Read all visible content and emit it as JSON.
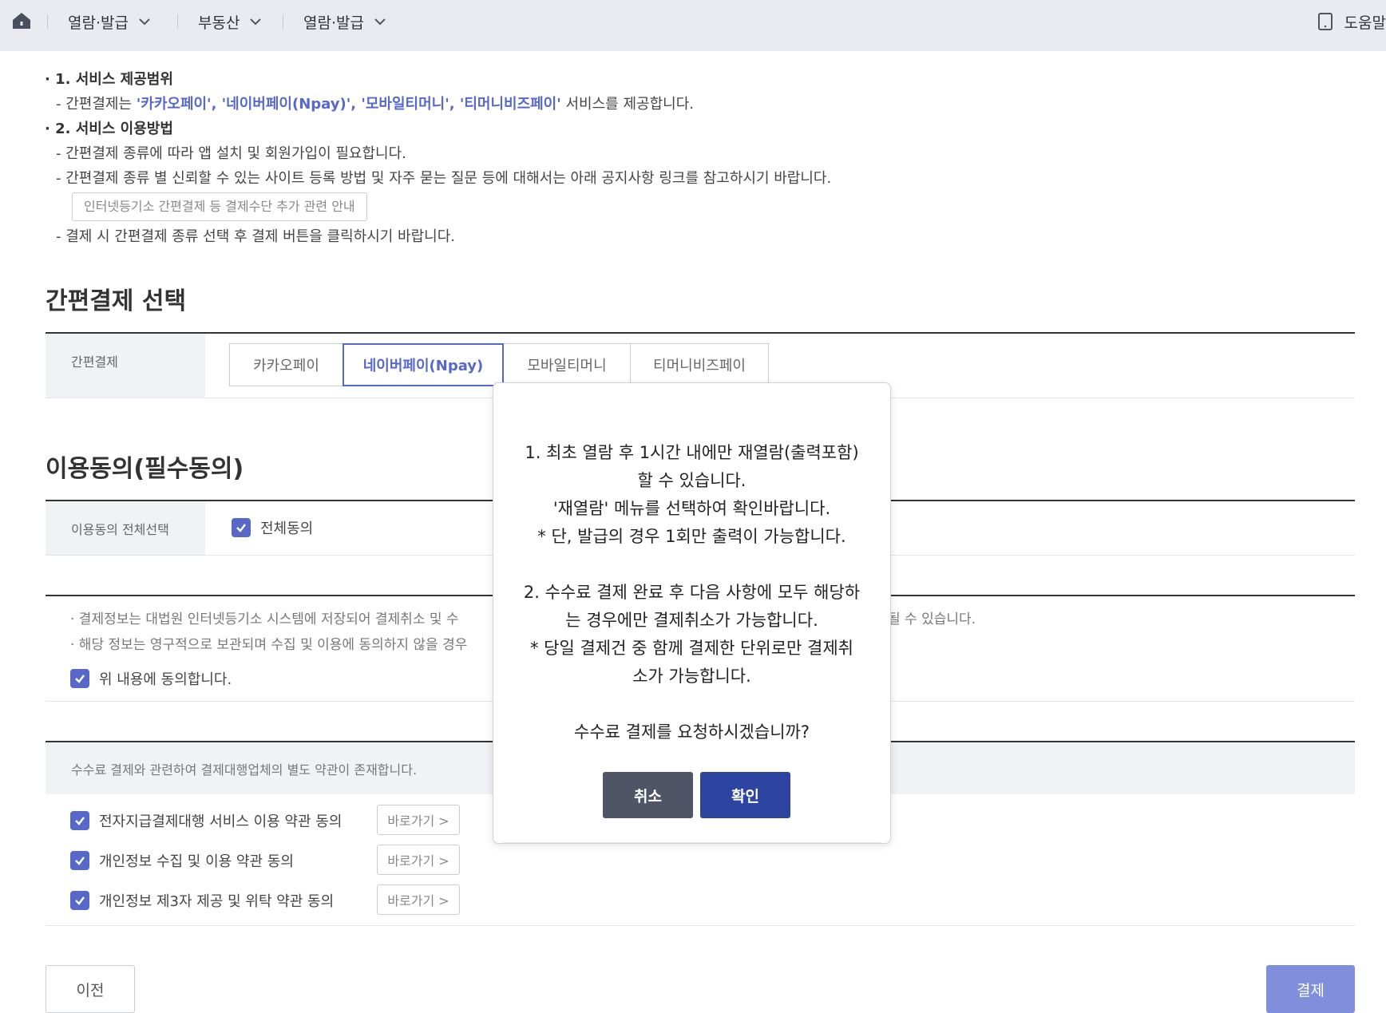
{
  "nav": {
    "items": [
      {
        "label": "열람·발급"
      },
      {
        "label": "부동산"
      },
      {
        "label": "열람·발급"
      }
    ],
    "help_label": "도움말"
  },
  "info": {
    "s1_title": "· 1. 서비스 제공범위",
    "s1_line_prefix": "- 간편결제는 ",
    "s1_highlight": "'카카오페이', '네이버페이(Npay)', '모바일티머니', '티머니비즈페이'",
    "s1_line_suffix": " 서비스를 제공합니다.",
    "s2_title": "· 2. 서비스 이용방법",
    "s2_line1": "- 간편결제 종류에 따라 앱 설치 및 회원가입이 필요합니다.",
    "s2_line2": "- 간편결제 종류 별 신뢰할 수 있는 사이트 등록 방법 및 자주 묻는 질문 등에 대해서는 아래 공지사항 링크를 참고하시기 바랍니다.",
    "notice_button": "인터넷등기소 간편결제 등 결제수단 추가 관련 안내",
    "s2_line3": "- 결제 시 간편결제 종류 선택 후 결제 버튼을 클릭하시기 바랍니다."
  },
  "easy_pay": {
    "section_title": "간편결제 선택",
    "label": "간편결제",
    "tabs": [
      {
        "label": "카카오페이"
      },
      {
        "label": "네이버페이(Npay)"
      },
      {
        "label": "모바일티머니"
      },
      {
        "label": "티머니비즈페이"
      }
    ],
    "selected": "네이버페이(Npay)"
  },
  "consent": {
    "section_title": "이용동의(필수동의)",
    "all_label": "이용동의 전체선택",
    "all_agree": "전체동의",
    "bullet1": "· 결제정보는 대법원 인터넷등기소 시스템에 저장되어 결제취소 및 수",
    "bullet1_tail": "될 수 있습니다.",
    "bullet2": "· 해당 정보는 영구적으로 보관되며 수집 및 이용에 동의하지 않을 경우",
    "agree_above": "위 내용에 동의합니다.",
    "pg_note": "수수료 결제와 관련하여 결제대행업체의 별도 약관이 존재합니다.",
    "terms": [
      {
        "label": "전자지급결제대행 서비스 이용 약관 동의",
        "button": "바로가기 >"
      },
      {
        "label": "개인정보 수집 및 이용 약관 동의",
        "button": "바로가기 >"
      },
      {
        "label": "개인정보 제3자 제공 및 위탁 약관 동의",
        "button": "바로가기 >"
      }
    ]
  },
  "footer": {
    "prev": "이전",
    "pay": "결제"
  },
  "modal": {
    "l1": "1. 최초 열람 후 1시간 내에만 재열람(출력포함)",
    "l2": "할 수 있습니다.",
    "l3": "'재열람' 메뉴를 선택하여 확인바랍니다.",
    "l4": "* 단, 발급의 경우 1회만 출력이 가능합니다.",
    "l5": "2. 수수료 결제 완료 후 다음 사항에 모두 해당하",
    "l6": "는 경우에만 결제취소가 가능합니다.",
    "l7": "* 당일 결제건 중 함께 결제한 단위로만 결제취",
    "l8": "소가 가능합니다.",
    "l9": "수수료 결제를 요청하시겠습니까?",
    "cancel": "취소",
    "ok": "확인"
  },
  "colors": {
    "accent": "#5868c8",
    "pay_button": "#7f8fdb",
    "modal_ok": "#2d44a0",
    "modal_cancel": "#4f5466"
  }
}
